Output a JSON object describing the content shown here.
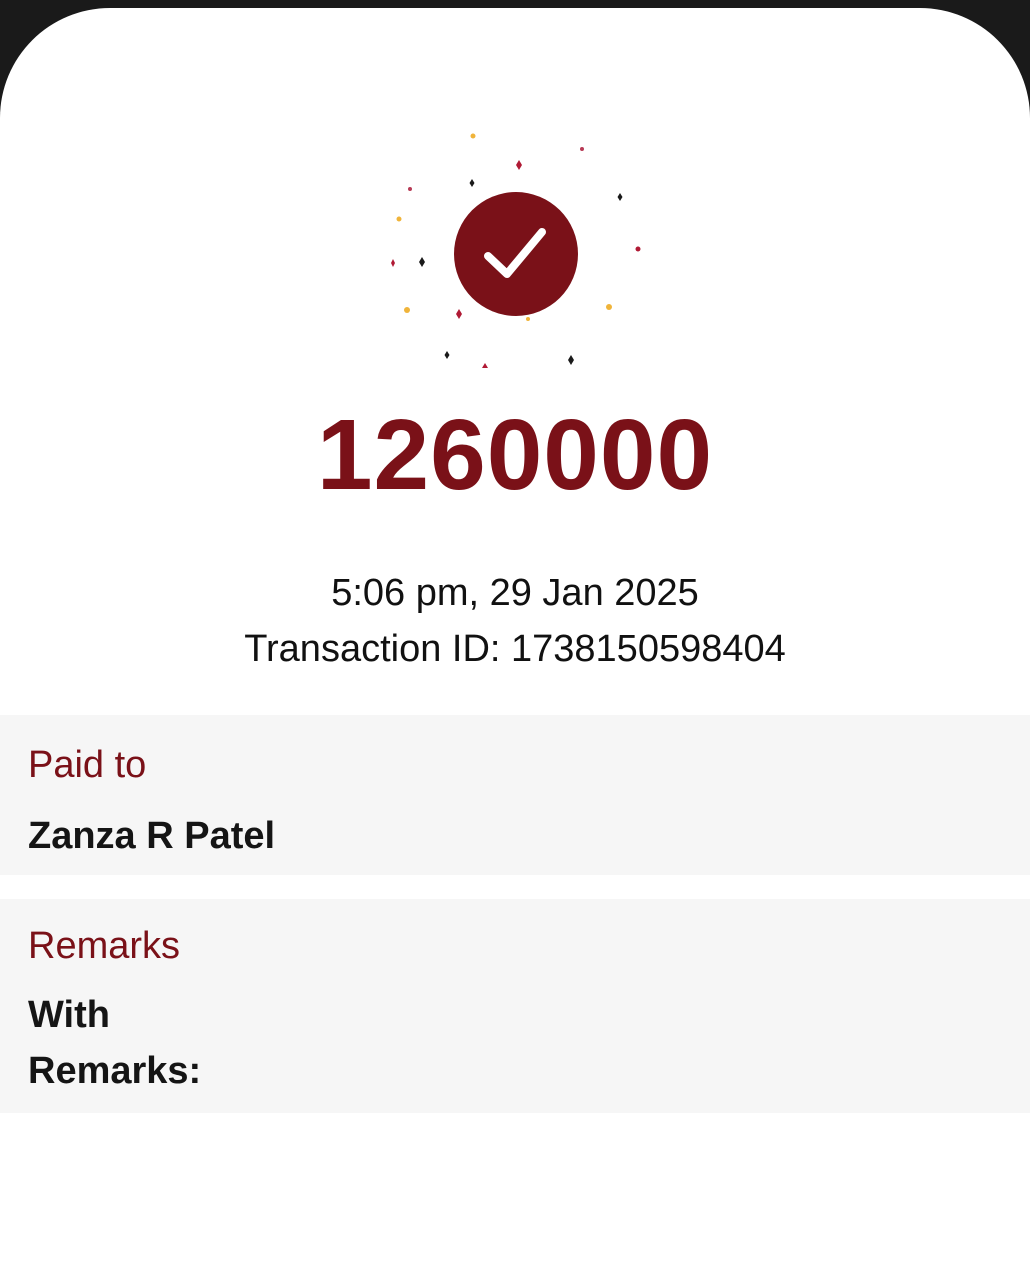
{
  "payment": {
    "amount": "1260000",
    "datetime": "5:06 pm, 29 Jan 2025",
    "transaction_id_text": "Transaction ID: 1738150598404"
  },
  "paid_to": {
    "label": "Paid to",
    "value": "Zanza R Patel"
  },
  "remarks": {
    "label": "Remarks",
    "value_line1": "With",
    "value_line2": "Remarks:"
  },
  "icons": {
    "status": "checkmark-circle-icon",
    "decoration": "confetti-sparkles"
  },
  "colors": {
    "accent": "#7a1118",
    "section_background": "#f6f6f6",
    "text_primary": "#111111",
    "confetti_gold": "#f0b43a",
    "confetti_dark": "#1a1a1a"
  }
}
